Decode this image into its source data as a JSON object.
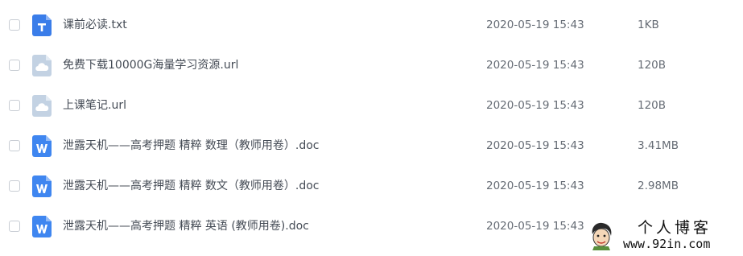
{
  "files": [
    {
      "name": "课前必读.txt",
      "date": "2020-05-19 15:43",
      "size": "1KB",
      "icon": "txt-file-icon",
      "type": "txt"
    },
    {
      "name": "免费下载10000G海量学习资源.url",
      "date": "2020-05-19 15:43",
      "size": "120B",
      "icon": "url-file-icon",
      "type": "url"
    },
    {
      "name": "上课笔记.url",
      "date": "2020-05-19 15:43",
      "size": "120B",
      "icon": "url-file-icon",
      "type": "url"
    },
    {
      "name": "泄露天机——高考押题 精粹 数理（教师用卷）.doc",
      "date": "2020-05-19 15:43",
      "size": "3.41MB",
      "icon": "word-file-icon",
      "type": "doc"
    },
    {
      "name": "泄露天机——高考押题 精粹 数文（教师用卷）.doc",
      "date": "2020-05-19 15:43",
      "size": "2.98MB",
      "icon": "word-file-icon",
      "type": "doc"
    },
    {
      "name": "泄露天机——高考押题 精粹 英语 (教师用卷).doc",
      "date": "2020-05-19 15:43",
      "size": "",
      "icon": "word-file-icon",
      "type": "doc"
    }
  ],
  "watermark": {
    "title": "个人博客",
    "url": "www.92in.com"
  },
  "colors": {
    "txt_icon": "#3a7de9",
    "doc_icon": "#3f86f0",
    "url_icon": "#c3d2e3",
    "text": "#444b55",
    "meta": "#666c75"
  }
}
